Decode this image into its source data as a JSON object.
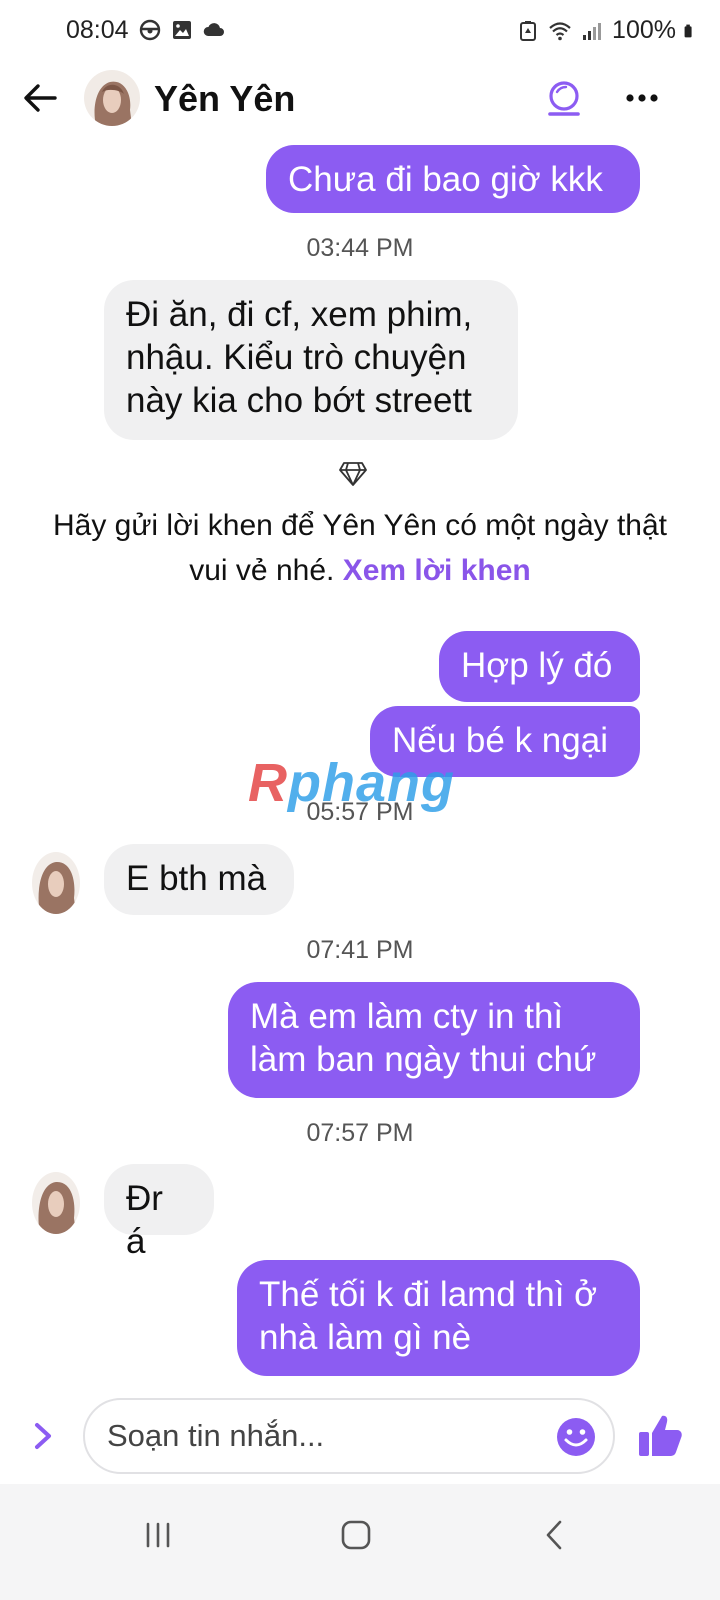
{
  "status_bar": {
    "time": "08:04",
    "battery": "100%",
    "icons": [
      "steering-wheel-icon",
      "image-icon",
      "cloud-icon",
      "battery-saver-icon",
      "wifi-icon",
      "signal-icon",
      "battery-icon"
    ]
  },
  "header": {
    "contact_name": "Yên Yên",
    "icons": [
      "back-arrow-icon",
      "avatar",
      "theme-icon",
      "more-icon"
    ]
  },
  "messages": [
    {
      "type": "out",
      "text": "Chưa đi bao giờ kkk"
    },
    {
      "type": "timestamp",
      "text": "03:44 PM"
    },
    {
      "type": "in",
      "text": "Đi ăn, đi cf, xem phim,\nnhậu. Kiểu trò chuyện\nnày kia cho bớt streett"
    },
    {
      "type": "out",
      "text": "Hợp lý đó"
    },
    {
      "type": "out",
      "text": "Nếu bé k ngại"
    },
    {
      "type": "timestamp",
      "text": "05:57 PM"
    },
    {
      "type": "in",
      "text": "E bth mà"
    },
    {
      "type": "timestamp",
      "text": "07:41 PM"
    },
    {
      "type": "out",
      "text": "Mà em làm cty in thì\nlàm ban ngày thui chứ"
    },
    {
      "type": "timestamp",
      "text": "07:57 PM"
    },
    {
      "type": "in",
      "text": "Đr á"
    },
    {
      "type": "out",
      "text": "Thế tối k đi lamd thì ở\nnhà làm gì nè"
    }
  ],
  "compliment": {
    "text": "Hãy gửi lời khen để Yên Yên có một ngày thật vui vẻ nhé.",
    "link": "Xem lời khen",
    "icon": "diamond-icon"
  },
  "watermark": {
    "part1": "R",
    "part2": "phang"
  },
  "composer": {
    "placeholder": "Soạn tin nhắn...",
    "icons": [
      "chevron-right-icon",
      "emoji-icon",
      "thumbs-up-icon"
    ]
  },
  "nav_bar": {
    "icons": [
      "recent-apps-icon",
      "home-icon",
      "back-icon"
    ]
  },
  "colors": {
    "accent": "#8c5cf2",
    "incoming_bubble": "#f0f0f1",
    "link": "#8a55e9"
  }
}
